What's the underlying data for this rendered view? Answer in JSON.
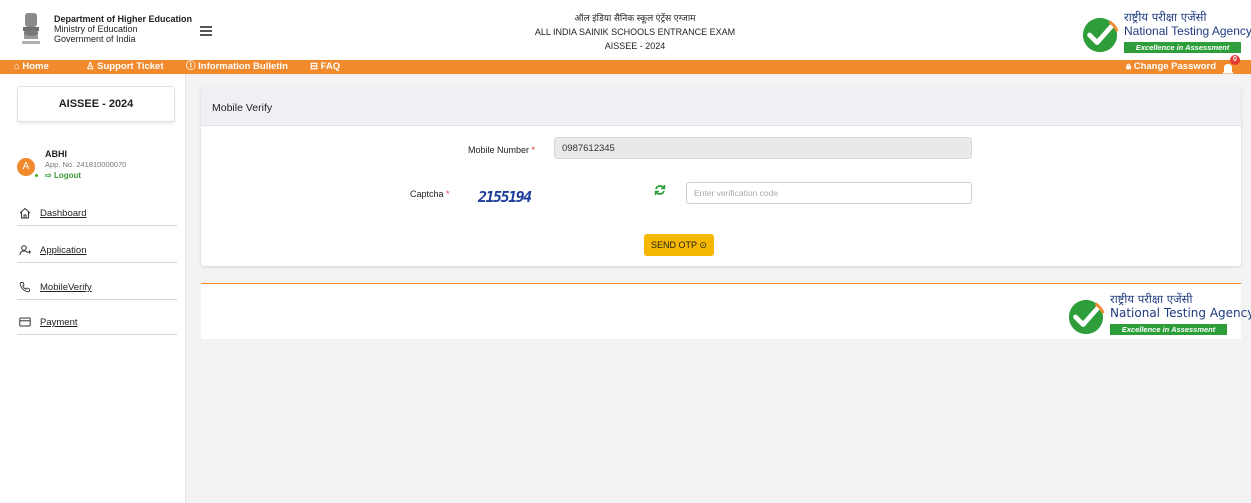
{
  "header": {
    "dept_title": "Department of Higher Education",
    "dept_ministry": "Ministry of Education",
    "dept_govt": "Government of India",
    "exam_hindi": "ऑल इंडिया सैनिक स्कूल एंट्रेंस एग्जाम",
    "exam_english": "ALL INDIA SAINIK SCHOOLS ENTRANCE EXAM",
    "exam_code": "AISSEE - 2024",
    "nta_hindi": "राष्ट्रीय परीक्षा एजेंसी",
    "nta_english": "National Testing Agency",
    "nta_tagline": "Excellence in Assessment"
  },
  "nav": {
    "home": "Home",
    "support": "Support Ticket",
    "bulletin": "Information Bulletin",
    "faq": "FAQ",
    "change_password": "Change Password",
    "notification_count": "0"
  },
  "sidebar": {
    "exam": "AISSEE - 2024",
    "user_initial": "A",
    "user_name": "ABHI",
    "app_no": "App. No. 241810000070",
    "logout": "Logout",
    "items": [
      {
        "label": "Dashboard",
        "icon": "home-icon"
      },
      {
        "label": "Application",
        "icon": "user-add-icon"
      },
      {
        "label": "MobileVerify",
        "icon": "phone-icon"
      },
      {
        "label": "Payment",
        "icon": "card-icon"
      }
    ]
  },
  "form": {
    "title": "Mobile Verify",
    "mobile_label": "Mobile Number",
    "mobile_value": "0987612345",
    "captcha_label": "Captcha",
    "captcha_text": "2155194",
    "verification_placeholder": "Enter verification code",
    "send_otp": "SEND OTP"
  },
  "colors": {
    "accent": "#f08a2c",
    "button": "#f5b700",
    "nta_green": "#2e9e3a",
    "nta_blue": "#1f3b80"
  }
}
